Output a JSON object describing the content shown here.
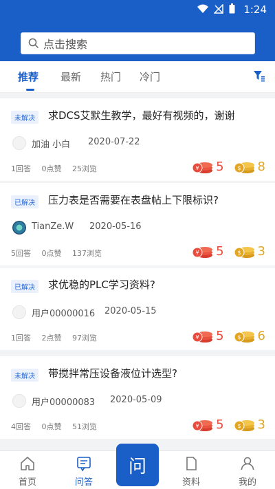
{
  "status": {
    "time": "1:24"
  },
  "search": {
    "placeholder": "点击搜索"
  },
  "tabs": [
    {
      "label": "推荐",
      "active": true
    },
    {
      "label": "最新",
      "active": false
    },
    {
      "label": "热门",
      "active": false
    },
    {
      "label": "冷门",
      "active": false
    }
  ],
  "questions": [
    {
      "badge": "未解决",
      "title": "求DCS艾默生教学，最好有视频的，谢谢",
      "author": "加油 小白",
      "date": "2020-07-22",
      "answers": "1回答",
      "likes": "0点赞",
      "views": "25浏览",
      "reward_red": "5",
      "reward_gold": "8"
    },
    {
      "badge": "已解决",
      "title": "压力表是否需要在表盘帖上下限标识?",
      "author": "TianZe.W",
      "date": "2020-05-16",
      "answers": "5回答",
      "likes": "0点赞",
      "views": "137浏览",
      "reward_red": "5",
      "reward_gold": "3"
    },
    {
      "badge": "已解决",
      "title": "求优稳的PLC学习资料?",
      "author": "用户00000016",
      "date": "2020-05-15",
      "answers": "1回答",
      "likes": "2点赞",
      "views": "97浏览",
      "reward_red": "5",
      "reward_gold": "6"
    },
    {
      "badge": "未解决",
      "title": "带搅拌常压设备液位计选型?",
      "author": "用户00000083",
      "date": "2020-05-09",
      "answers": "4回答",
      "likes": "0点赞",
      "views": "51浏览",
      "reward_red": "5",
      "reward_gold": "3"
    }
  ],
  "bottom_nav": {
    "home": "首页",
    "qa": "问答",
    "ask": "问",
    "materials": "资料",
    "mine": "我的"
  },
  "colors": {
    "primary": "#1a5fc7",
    "red": "#e94b3c",
    "gold": "#e2a623"
  }
}
